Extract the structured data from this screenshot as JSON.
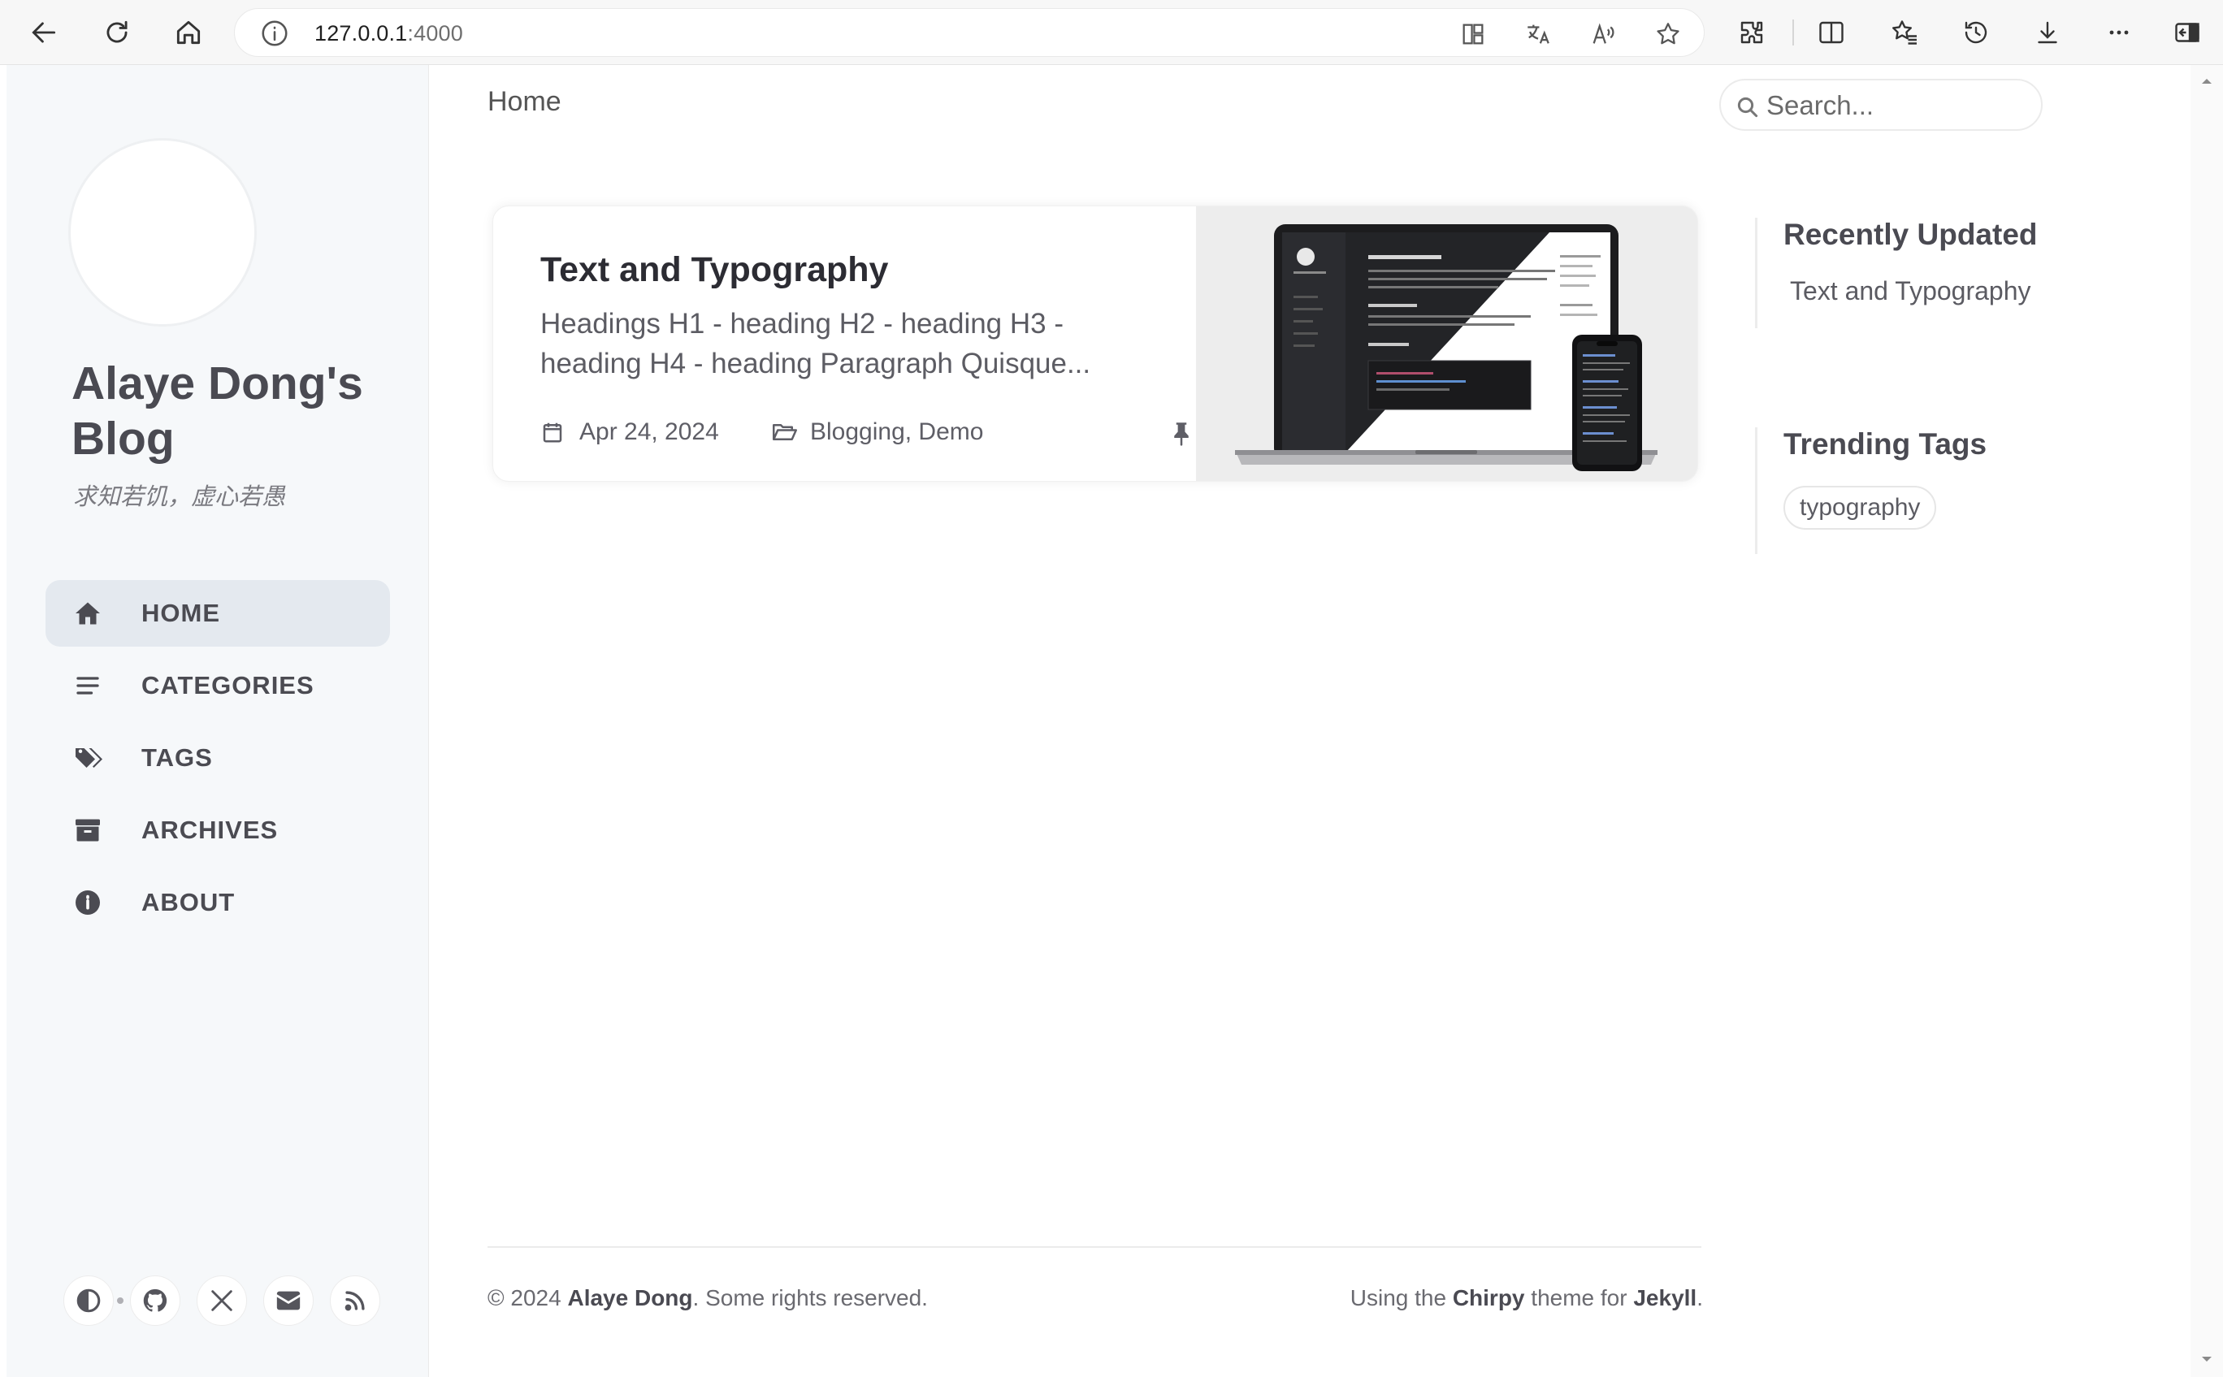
{
  "browser": {
    "url_host": "127.0.0.1",
    "url_port": ":4000",
    "icons": [
      "back-icon",
      "refresh-icon",
      "home-icon",
      "info-icon",
      "app-available-icon",
      "translate-icon",
      "read-aloud-icon",
      "favorite-star-icon",
      "extensions-icon",
      "split-screen-icon",
      "favorites-icon",
      "history-icon",
      "downloads-icon",
      "more-icon",
      "sidebar-toggle-icon"
    ]
  },
  "sidebar": {
    "title": "Alaye Dong's Blog",
    "subtitle": "求知若饥，虚心若愚",
    "nav": [
      {
        "label": "HOME",
        "icon": "home-icon",
        "active": true
      },
      {
        "label": "CATEGORIES",
        "icon": "list-icon",
        "active": false
      },
      {
        "label": "TAGS",
        "icon": "tags-icon",
        "active": false
      },
      {
        "label": "ARCHIVES",
        "icon": "archive-icon",
        "active": false
      },
      {
        "label": "ABOUT",
        "icon": "info-circle-icon",
        "active": false
      }
    ],
    "social_icons": [
      "theme-toggle-icon",
      "github-icon",
      "x-twitter-icon",
      "email-icon",
      "rss-icon"
    ]
  },
  "topbar": {
    "breadcrumb": "Home",
    "search_placeholder": "Search..."
  },
  "post": {
    "title": "Text and Typography",
    "excerpt": "Headings H1 - heading H2 - heading H3 - heading H4 - heading Paragraph Quisque...",
    "date": "Apr 24, 2024",
    "categories": "Blogging, Demo",
    "pinned": true
  },
  "panels": {
    "recently_updated_heading": "Recently Updated",
    "recently_updated": [
      "Text and Typography"
    ],
    "trending_tags_heading": "Trending Tags",
    "trending_tags": [
      "typography"
    ]
  },
  "footer": {
    "copyright_prefix": "© 2024 ",
    "author": "Alaye Dong",
    "copyright_suffix": ". Some rights reserved.",
    "using_prefix": "Using the ",
    "theme": "Chirpy",
    "theme_middle": " theme for ",
    "engine": "Jekyll",
    "end": "."
  },
  "colors": {
    "sidebar_bg": "#f6f8fa",
    "nav_active_bg": "#e4e9ef",
    "text_main": "#34343c"
  }
}
